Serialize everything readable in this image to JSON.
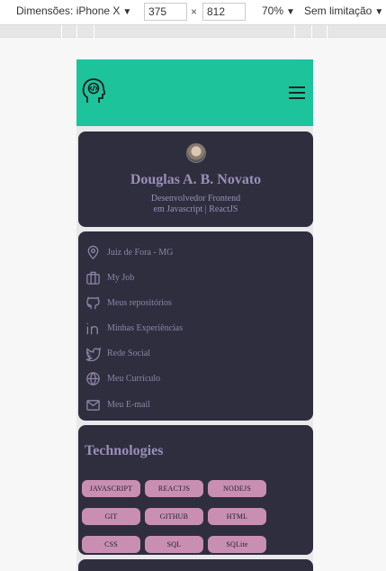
{
  "devtools": {
    "device_label": "Dimensões: iPhone X",
    "width": "375",
    "height": "812",
    "times": "×",
    "zoom": "70%",
    "throttle": "Sem limitação"
  },
  "profile": {
    "name": "Douglas A. B. Novato",
    "role_line1": "Desenvolvedor Frontend",
    "role_line2": "em Javascript | ReactJS"
  },
  "links": [
    {
      "icon": "map-pin-icon",
      "label": "Juiz de Fora - MG"
    },
    {
      "icon": "briefcase-icon",
      "label": "My Job"
    },
    {
      "icon": "github-icon",
      "label": "Meus repositórios"
    },
    {
      "icon": "linkedin-icon",
      "label": "Minhas Experiências"
    },
    {
      "icon": "twitter-icon",
      "label": "Rede Social"
    },
    {
      "icon": "globe-icon",
      "label": "Meu Currículo"
    },
    {
      "icon": "mail-icon",
      "label": "Meu E-mail"
    }
  ],
  "technologies": {
    "title": "Technologies",
    "items": [
      "JAVASCRIPT",
      "REACTJS",
      "NODEJS",
      "GIT",
      "GITHUB",
      "HTML",
      "CSS",
      "SQL",
      "SQLite"
    ]
  },
  "colors": {
    "header": "#1dc49b",
    "card": "#2f2e3e",
    "accent_text": "#9a8fb8",
    "pill": "#c98fb2"
  }
}
